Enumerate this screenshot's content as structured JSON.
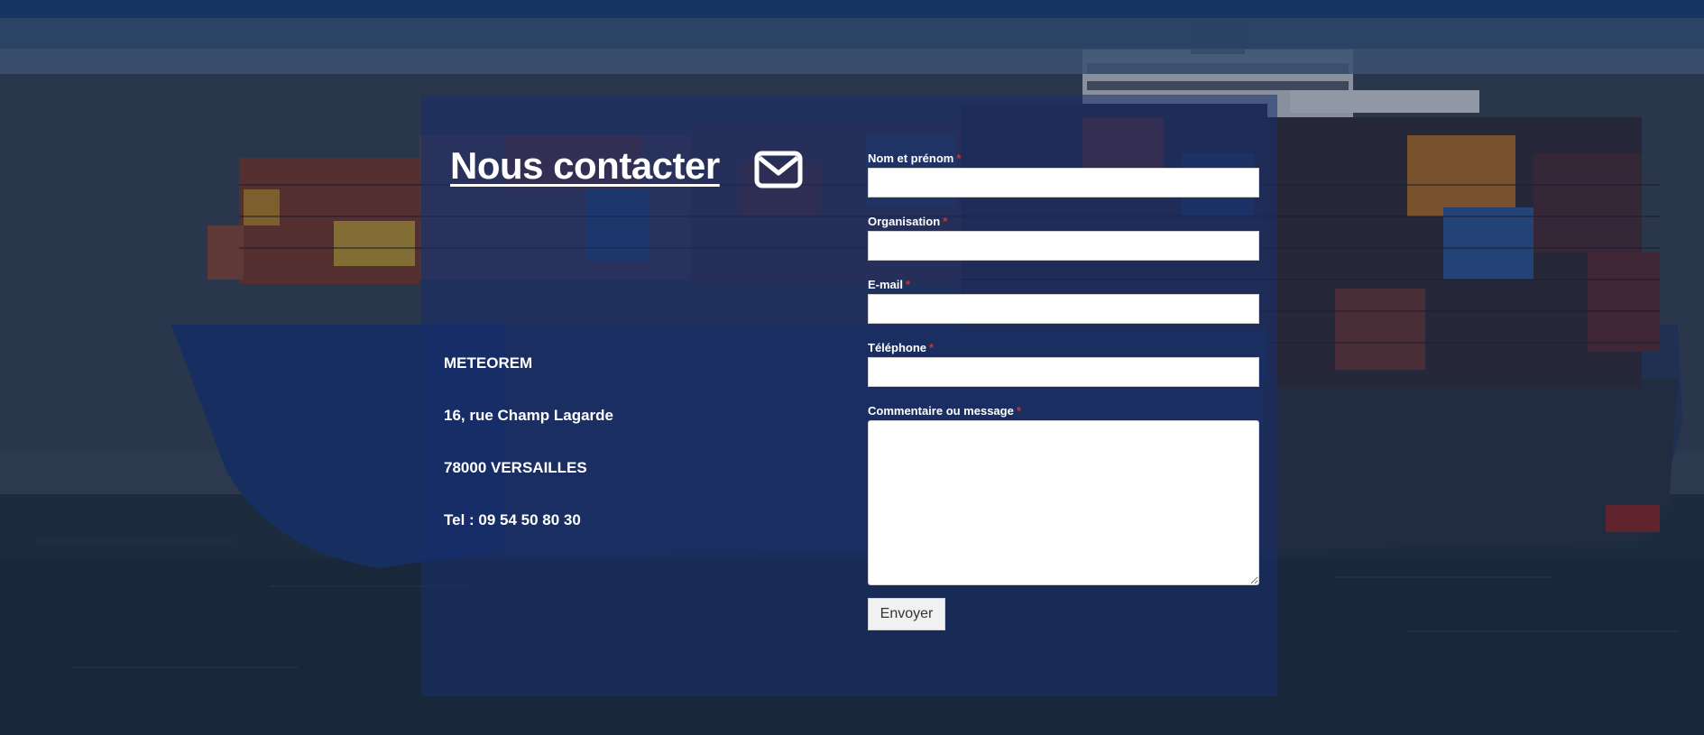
{
  "contact": {
    "title": "Nous contacter",
    "mail_icon": "envelope-icon"
  },
  "address": {
    "company": "METEOREM",
    "street": "16, rue Champ Lagarde",
    "city": "78000 VERSAILLES",
    "phone": "Tel : 09 54 50 80 30"
  },
  "form": {
    "fields": [
      {
        "label": "Nom et prénom",
        "required": "*",
        "value": ""
      },
      {
        "label": "Organisation",
        "required": "*",
        "value": ""
      },
      {
        "label": "E-mail",
        "required": "*",
        "value": ""
      },
      {
        "label": "Téléphone",
        "required": "*",
        "value": ""
      }
    ],
    "message": {
      "label": "Commentaire ou message",
      "required": "*",
      "value": ""
    },
    "submit_label": "Envoyer"
  },
  "colors": {
    "panel_overlay": "#182e6e",
    "required": "#c0392b",
    "text": "#ffffff"
  }
}
